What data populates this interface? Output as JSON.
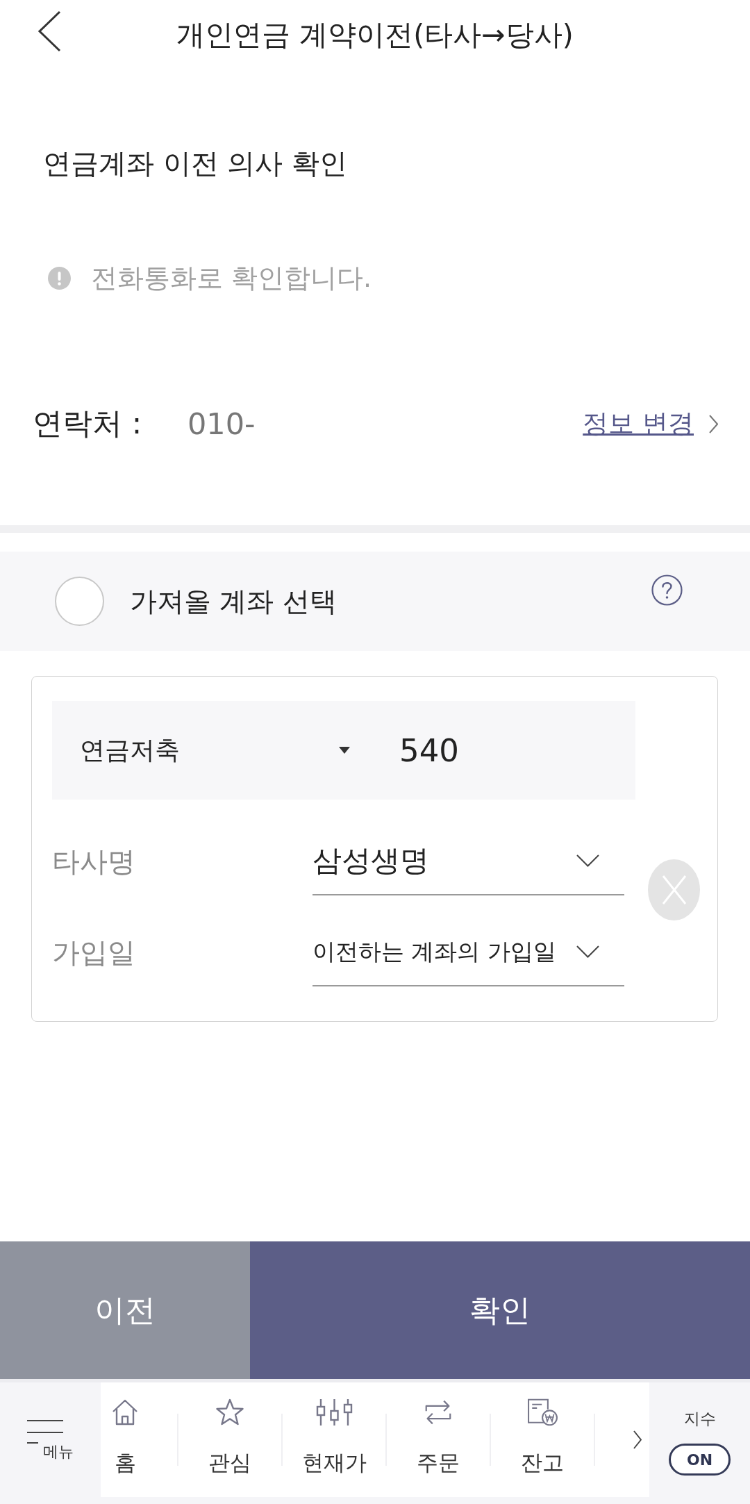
{
  "header": {
    "title": "개인연금 계약이전(타사→당사)"
  },
  "intent": {
    "title": "연금계좌 이전 의사 확인",
    "notice": "전화통화로 확인합니다."
  },
  "contact": {
    "label": "연락처 :",
    "value": "010-",
    "link": "정보 변경"
  },
  "account_select": {
    "label": "가져올 계좌 선택",
    "checked": false
  },
  "account": {
    "type": "연금저축",
    "number": "540",
    "fields": [
      {
        "label": "타사명",
        "kind": "select",
        "value": "삼성생명"
      },
      {
        "label": "가입일",
        "kind": "select",
        "placeholder": "이전하는 계좌의 가입일"
      }
    ]
  },
  "actions": [
    {
      "label": "이전",
      "kind": "secondary"
    },
    {
      "label": "확인",
      "kind": "primary"
    }
  ],
  "bottom_nav": {
    "menu": "메뉴",
    "tabs": [
      {
        "label": "홈"
      },
      {
        "label": "관심"
      },
      {
        "label": "현재가"
      },
      {
        "label": "주문"
      },
      {
        "label": "잔고"
      }
    ],
    "index": {
      "label": "지수",
      "toggle": "ON"
    }
  }
}
